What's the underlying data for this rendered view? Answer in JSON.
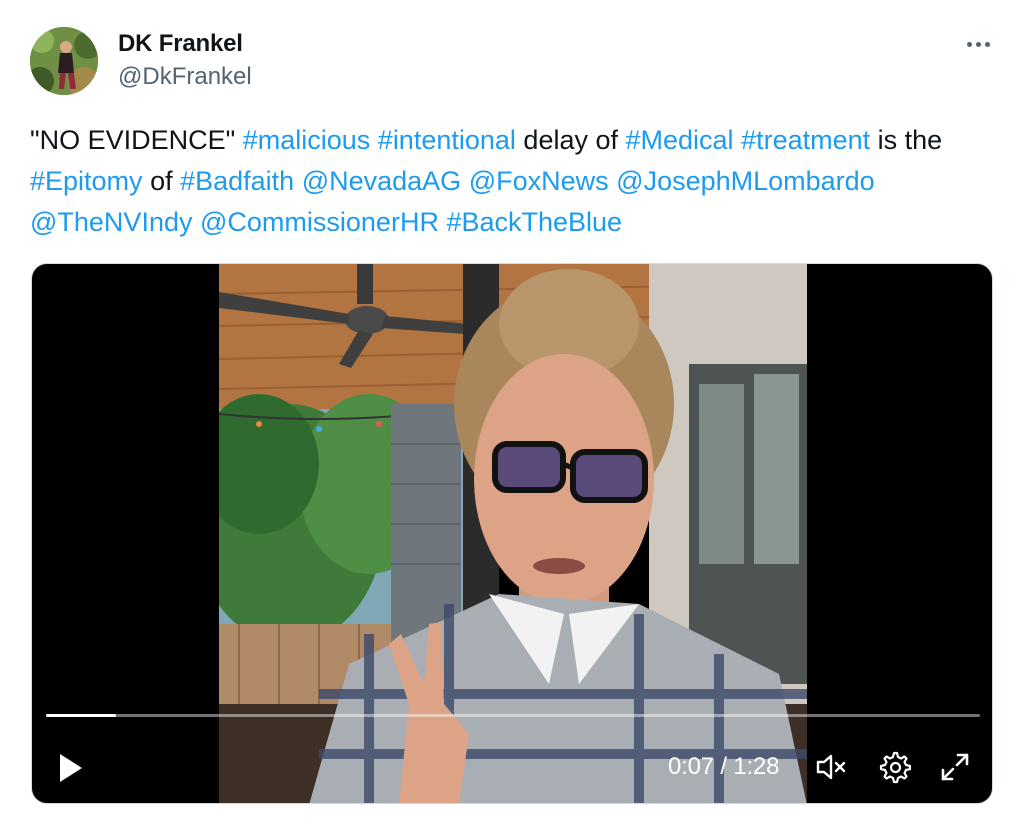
{
  "author": {
    "display_name": "DK Frankel",
    "handle": "@DkFrankel",
    "avatar_icon": "profile-photo"
  },
  "more_icon": "more-horizontal-icon",
  "tweet": {
    "segments": [
      {
        "text": "\"NO EVIDENCE\" ",
        "link": false
      },
      {
        "text": "#malicious",
        "link": true
      },
      {
        "text": " ",
        "link": false
      },
      {
        "text": "#intentional",
        "link": true
      },
      {
        "text": " delay of ",
        "link": false
      },
      {
        "text": "#Medical",
        "link": true
      },
      {
        "text": " ",
        "link": false
      },
      {
        "text": "#treatment",
        "link": true
      },
      {
        "text": " is the ",
        "link": false
      },
      {
        "text": "#Epitomy",
        "link": true
      },
      {
        "text": " of ",
        "link": false
      },
      {
        "text": "#Badfaith",
        "link": true
      },
      {
        "text": " ",
        "link": false
      },
      {
        "text": "@NevadaAG",
        "link": true
      },
      {
        "text": " ",
        "link": false
      },
      {
        "text": "@FoxNews",
        "link": true
      },
      {
        "text": " ",
        "link": false
      },
      {
        "text": "@JosephMLombardo",
        "link": true
      },
      {
        "text": " ",
        "link": false
      },
      {
        "text": "@TheNVIndy",
        "link": true
      },
      {
        "text": " ",
        "link": false
      },
      {
        "text": "@CommissionerHR",
        "link": true
      },
      {
        "text": " ",
        "link": false
      },
      {
        "text": "#BackTheBlue",
        "link": true
      }
    ]
  },
  "video": {
    "time_display": "0:07 / 1:28",
    "progress_fraction": 0.075,
    "icons": [
      "play-icon",
      "mute-icon",
      "settings-gear-icon",
      "fullscreen-icon"
    ]
  },
  "colors": {
    "link": "#1d9bf0",
    "text": "#0f1419",
    "secondary": "#536471"
  }
}
